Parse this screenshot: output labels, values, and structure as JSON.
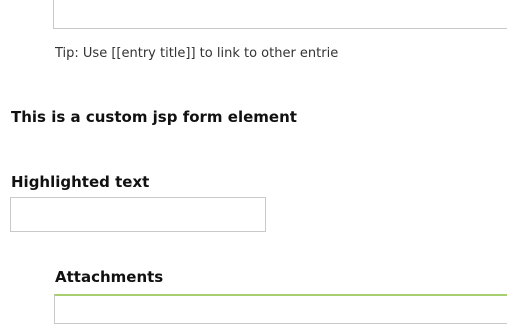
{
  "textarea": {
    "value": ""
  },
  "tip": {
    "text": "Tip: Use [[entry title]] to link to other entrie"
  },
  "custom_element": {
    "text": "This is a custom jsp form element"
  },
  "highlighted_text": {
    "label": "Highlighted text",
    "value": "",
    "placeholder": ""
  },
  "attachments": {
    "label": "Attachments"
  },
  "colors": {
    "field_border": "#c9c9c9",
    "attachments_accent": "#a7cf6f"
  }
}
